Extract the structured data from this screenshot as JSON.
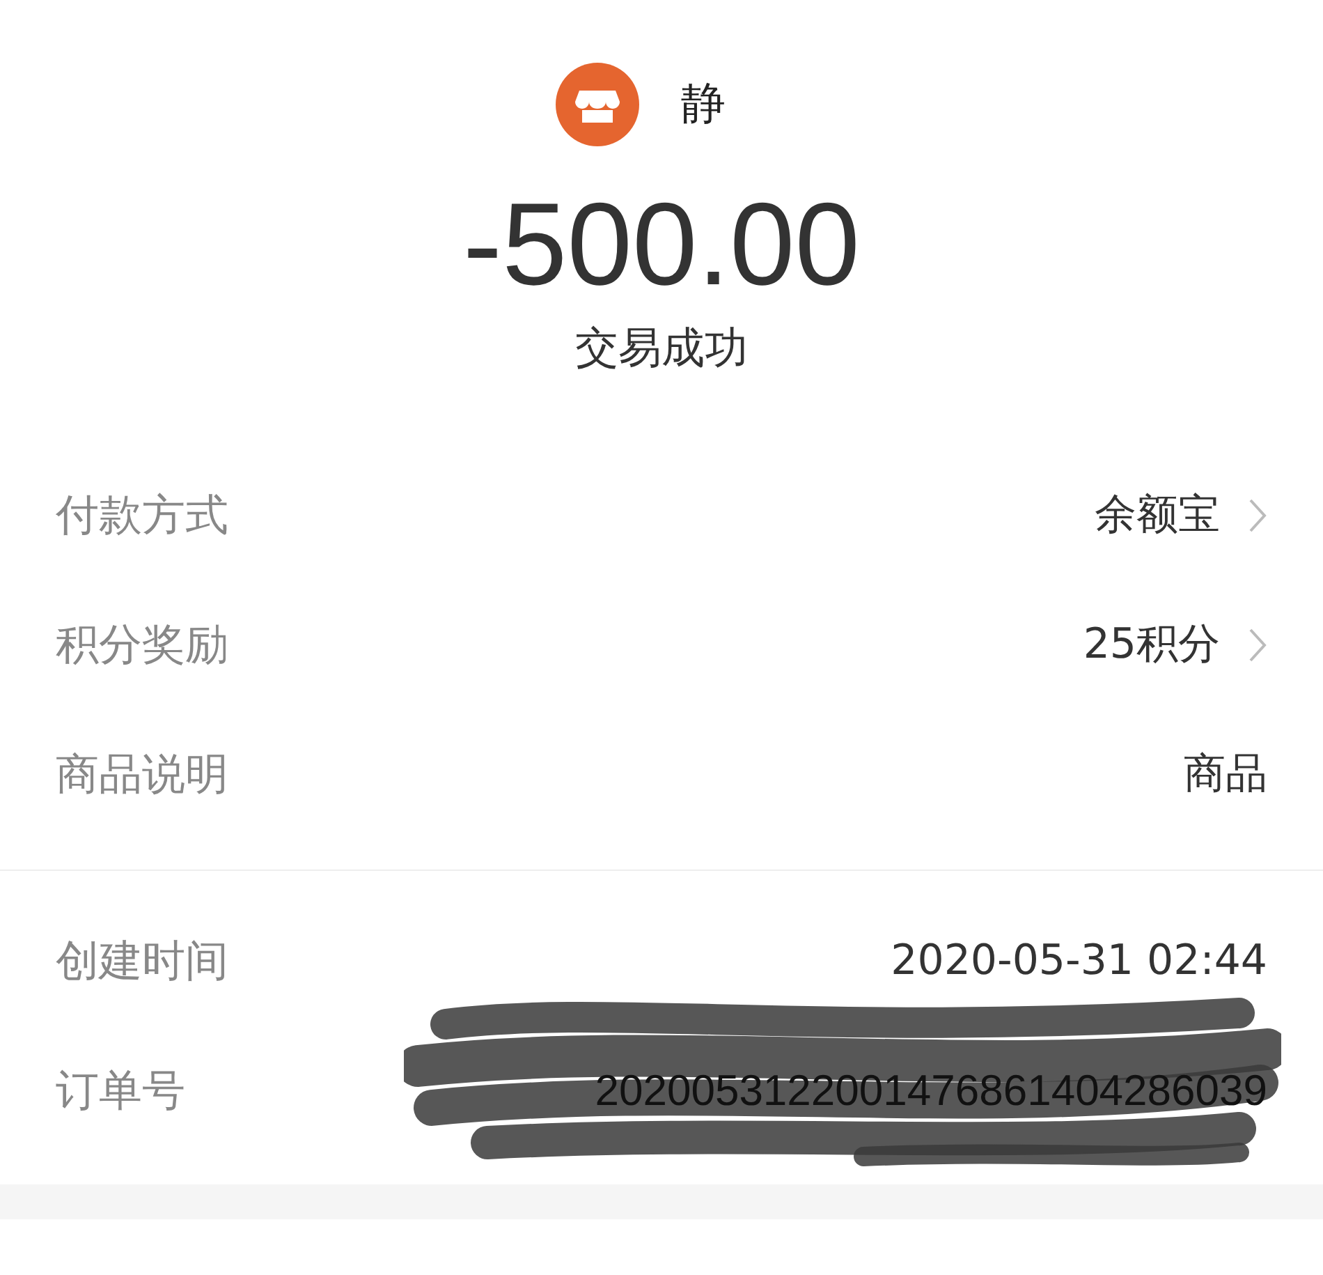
{
  "header": {
    "merchant_name": "静"
  },
  "amount": "-500.00",
  "status": "交易成功",
  "sections": [
    {
      "rows": [
        {
          "label": "付款方式",
          "value": "余额宝",
          "has_arrow": true,
          "redacted": false
        },
        {
          "label": "积分奖励",
          "value": "25积分",
          "has_arrow": true,
          "redacted": false
        },
        {
          "label": "商品说明",
          "value": "商品",
          "has_arrow": false,
          "redacted": false
        }
      ]
    },
    {
      "rows": [
        {
          "label": "创建时间",
          "value": "2020-05-31 02:44",
          "has_arrow": false,
          "redacted": false
        },
        {
          "label": "订单号",
          "value": "2020053122001476861404286039",
          "has_arrow": false,
          "redacted": true
        }
      ]
    }
  ]
}
